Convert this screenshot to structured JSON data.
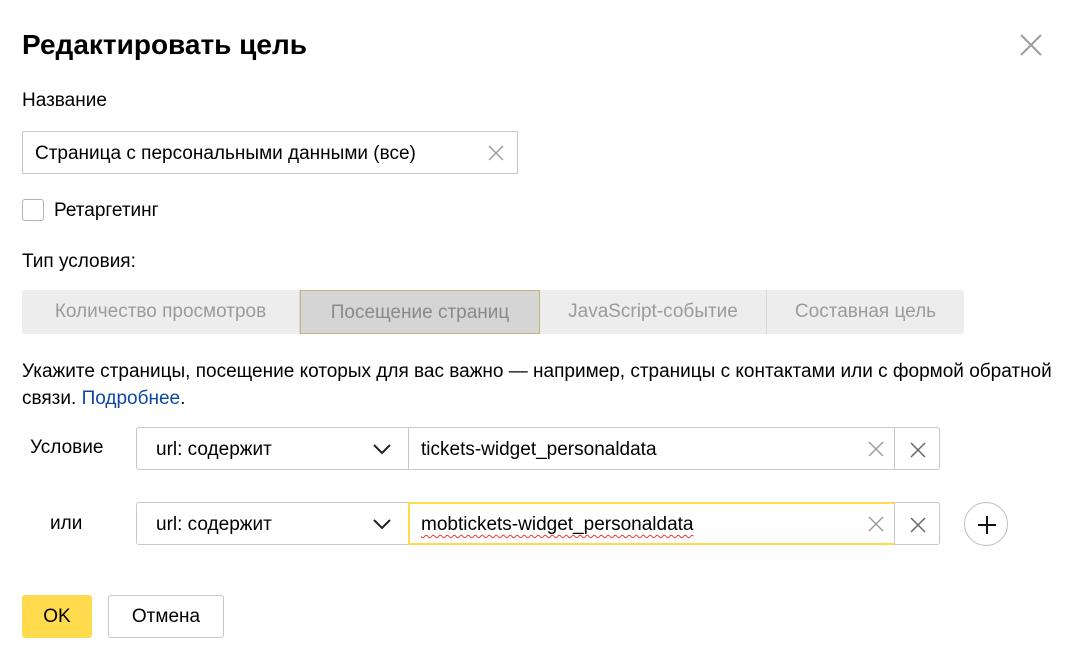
{
  "dialog": {
    "title": "Редактировать цель",
    "close_icon": "close-icon"
  },
  "name_field": {
    "label": "Название",
    "value": "Страница с персональными данными (все)"
  },
  "retargeting": {
    "label": "Ретаргетинг",
    "checked": false
  },
  "condition_type": {
    "label": "Тип условия:",
    "tabs": [
      {
        "label": "Количество просмотров",
        "active": false
      },
      {
        "label": "Посещение страниц",
        "active": true
      },
      {
        "label": "JavaScript-событие",
        "active": false
      },
      {
        "label": "Составная цель",
        "active": false
      }
    ]
  },
  "description": {
    "text": "Укажите страницы, посещение которых для вас важно — например, страницы с контактами или с формой обратной связи. ",
    "link": "Подробнее",
    "end": "."
  },
  "conditions": [
    {
      "label": "Условие",
      "operator": "url: содержит",
      "value": "tickets-widget_personaldata",
      "focused": false
    },
    {
      "label": "или",
      "operator": "url: содержит",
      "value": "mobtickets-widget_personaldata",
      "focused": true
    }
  ],
  "actions": {
    "ok_label": "OK",
    "cancel_label": "Отмена"
  },
  "colors": {
    "accent": "#ffdb4d",
    "link": "#0d47a1",
    "tab_bg": "#ededed"
  }
}
